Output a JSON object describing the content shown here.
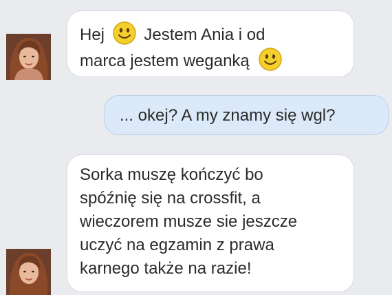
{
  "chat": {
    "messages": [
      {
        "direction": "incoming",
        "lines": [
          "Hej",
          "Jestem Ania i od",
          "marca jestem weganką"
        ],
        "emoji": "smiley-emoji"
      },
      {
        "direction": "outgoing",
        "text": "... okej? A my znamy się wgl?"
      },
      {
        "direction": "incoming",
        "lines": [
          "Sorka muszę kończyć bo",
          "spóźnię się na crossfit, a",
          "wieczorem musze sie jeszcze",
          "uczyć na egzamin z prawa",
          "karnego także na razie!"
        ]
      }
    ]
  },
  "colors": {
    "background": "#e9ebee",
    "incoming_bubble": "#ffffff",
    "outgoing_bubble": "#dbe9f8",
    "text": "#2b2b2b",
    "emoji_yellow": "#f5cf2b"
  }
}
